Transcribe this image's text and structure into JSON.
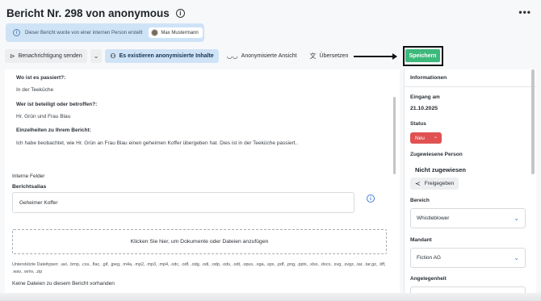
{
  "header": {
    "title": "Bericht Nr. 298 von anonymous",
    "more": "•••"
  },
  "banner": {
    "text": "Dieser Bericht wurde von einer internen Person erstellt",
    "user": "Max Mustermann"
  },
  "toolbar": {
    "notify": "Benachrichtigung senden",
    "anon_content": "Es existieren anonymisierte Inhalte",
    "anon_view": "Anonymisierte Ansicht",
    "translate": "Übersetzen",
    "save": "Speichern"
  },
  "report": {
    "q1": "Wo ist es passiert?:",
    "a1": "In der Teeküche",
    "q2": "Wer ist beteiligt oder betroffen?:",
    "a2": "Hr. Grün und Frau Blau",
    "q3": "Einzelheiten zu Ihrem Bericht:",
    "a3": "Ich habe beobachtet, wie Hr. Grün an Frau Blau einen geheimen Koffer übergeben hat. Dies ist in der Teeküche passiert.."
  },
  "internal": {
    "section": "Interne Felder",
    "alias_label": "Berichtsalias",
    "alias_value": "Geheimer Koffer",
    "upload": "Klicken Sie hier, um Dokumente oder Dateien anzufügen",
    "types": "Unterstützte Dateitypen: .avi, .bmp, .css, .flac, .gif, .jpeg, .m4a, .mp2, .mp3, .mp4, .odc, .odf, .odg, .odi, .odp, .ods, .odt, .opus, .oga, .spx, .pdf, .png, .pptx, .xlsx, .docx, .svg, .svgz, .tar, .tar.gz, .tiff, .wav, .wmv, .zip",
    "no_files": "Keine Dateien zu diesem Bericht vorhanden"
  },
  "sidebar": {
    "title": "Informationen",
    "received_label": "Eingang am",
    "received_value": "21.10.2025",
    "status_label": "Status",
    "status_value": "Neu",
    "assigned_label": "Zugewiesene Person",
    "assigned_value": "Nicht zugewiesen",
    "shared": "Freigegeben",
    "area_label": "Bereich",
    "area_value": "Whistleblower",
    "client_label": "Mandant",
    "client_value": "Fiction AG",
    "matter_label": "Angelegenheit"
  },
  "colors": {
    "save": "#3cb97b",
    "status": "#e05252",
    "active": "#cfe3f7"
  }
}
